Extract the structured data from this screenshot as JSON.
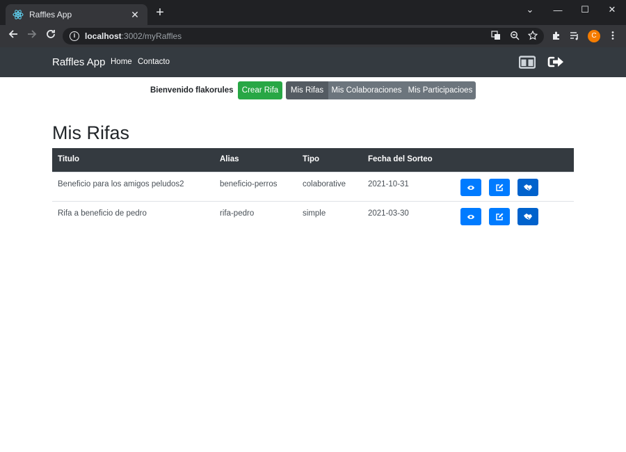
{
  "browser": {
    "tab_title": "Raffles App",
    "tab_close": "✕",
    "new_tab": "+",
    "url_host": "localhost",
    "url_rest": ":3002/myRaffles",
    "profile_initial": "C",
    "window_controls": [
      "⌄",
      "—",
      "☐",
      "✕"
    ]
  },
  "navbar": {
    "brand": "Raffles App",
    "links": [
      "Home",
      "Contacto"
    ]
  },
  "content": {
    "welcome": "Bienvenido flakorules",
    "create_button": "Crear Rifa",
    "segments": [
      "Mis Rifas",
      "Mis Colaboraciones",
      "Mis Participacioes"
    ],
    "active_segment": "Mis Rifas",
    "page_title": "Mis Rifas"
  },
  "table": {
    "headers": [
      "Titulo",
      "Alias",
      "Tipo",
      "Fecha del Sorteo"
    ],
    "rows": [
      [
        "Beneficio para los amigos peludos2",
        "beneficio-perros",
        "colaborative",
        "2021-10-31"
      ],
      [
        "Rifa a beneficio de pedro",
        "rifa-pedro",
        "simple",
        "2021-03-30"
      ]
    ],
    "row_actions": [
      "eye-icon",
      "edit-icon",
      "handshake-icon"
    ]
  },
  "colors": {
    "navbar": "#343a40",
    "success": "#28a745",
    "primary": "#007bff",
    "secondary": "#6c757d"
  }
}
